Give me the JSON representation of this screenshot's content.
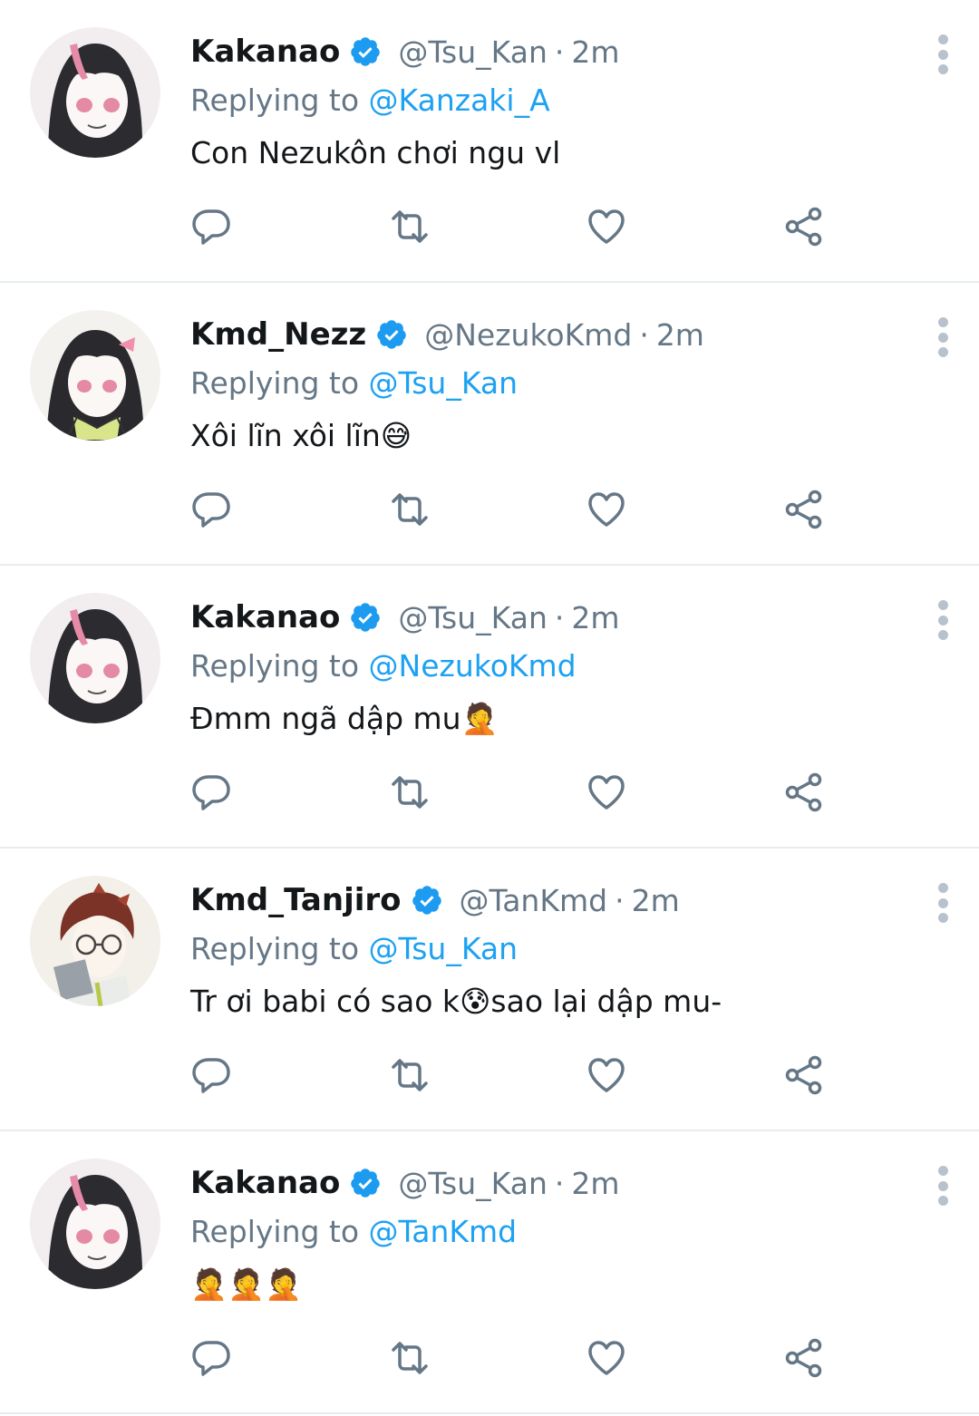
{
  "colors": {
    "accent": "#1da1f2",
    "verified": "#1d9bf0",
    "secondary_text": "#657786",
    "icon": "#657786",
    "divider": "#e6ecf0"
  },
  "reply_prefix": "Replying to",
  "tweets": [
    {
      "display_name": "Kakanao",
      "handle": "@Tsu_Kan",
      "separator": "·",
      "time": "2m",
      "reply_to": "@Kanzaki_A",
      "text": "Con Nezukôn chơi ngu vl",
      "avatar_icon": "anime-girl-avatar-icon"
    },
    {
      "display_name": "Kmd_Nezz",
      "handle": "@NezukoKmd",
      "separator": "·",
      "time": "2m",
      "reply_to": "@Tsu_Kan",
      "text": "Xôi lĩn xôi lĩn😅",
      "avatar_icon": "anime-girl-avatar-icon"
    },
    {
      "display_name": "Kakanao",
      "handle": "@Tsu_Kan",
      "separator": "·",
      "time": "2m",
      "reply_to": "@NezukoKmd",
      "text": "Đmm ngã dập mu🤦",
      "avatar_icon": "anime-girl-avatar-icon"
    },
    {
      "display_name": "Kmd_Tanjiro",
      "handle": "@TanKmd",
      "separator": "·",
      "time": "2m",
      "reply_to": "@Tsu_Kan",
      "text": "Tr ơi babi có sao k😰sao lại dập mu-",
      "avatar_icon": "anime-boy-avatar-icon"
    },
    {
      "display_name": "Kakanao",
      "handle": "@Tsu_Kan",
      "separator": "·",
      "time": "2m",
      "reply_to": "@TanKmd",
      "text": "🤦🤦🤦",
      "avatar_icon": "anime-girl-avatar-icon"
    }
  ]
}
